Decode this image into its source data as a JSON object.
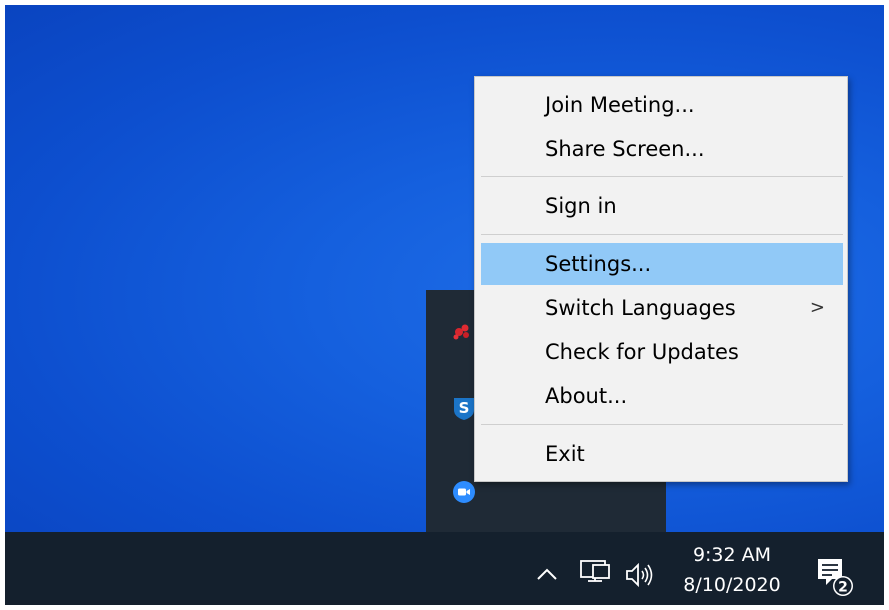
{
  "menu": {
    "items": [
      {
        "label": "Join Meeting..."
      },
      {
        "label": "Share Screen..."
      },
      {
        "label": "Sign in"
      },
      {
        "label": "Settings..."
      },
      {
        "label": "Switch Languages",
        "submenu": ">"
      },
      {
        "label": "Check for Updates"
      },
      {
        "label": "About..."
      },
      {
        "label": "Exit"
      }
    ],
    "highlighted": "Settings..."
  },
  "tray_flyout": {
    "icons": [
      "red-app-icon",
      "shield-s-icon",
      "zoom-camera-icon"
    ],
    "shield_letter": "S"
  },
  "taskbar": {
    "time": "9:32 AM",
    "date": "8/10/2020",
    "notification_count": "2",
    "icons": [
      "chevron-up-icon",
      "network-icon",
      "volume-icon",
      "notification-icon"
    ]
  },
  "colors": {
    "desktop": "#1560de",
    "taskbar": "#14202d",
    "menu_bg": "#f2f2f2",
    "menu_highlight": "#91c9f7"
  }
}
